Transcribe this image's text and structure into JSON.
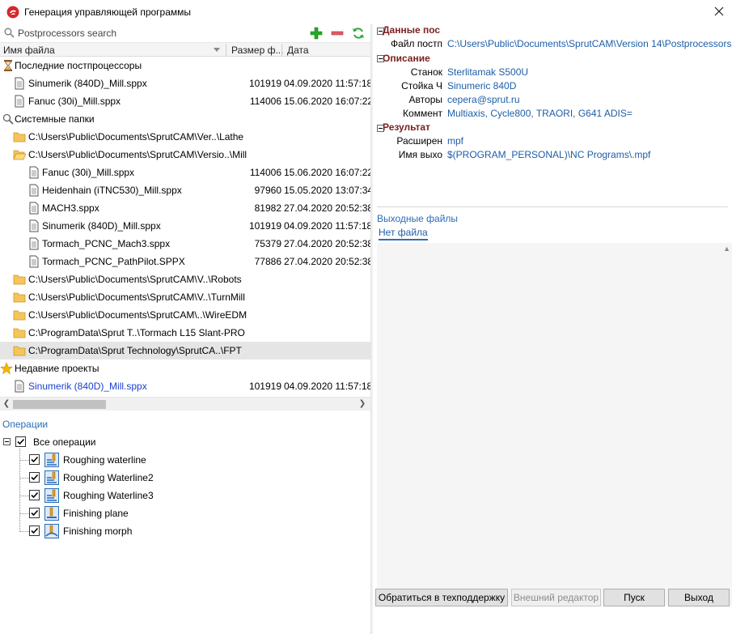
{
  "window": {
    "title": "Генерация управляющей программы"
  },
  "search": {
    "placeholder": "Postprocessors search"
  },
  "columns": {
    "name": "Имя файла",
    "size": "Размер ф...",
    "date": "Дата"
  },
  "tree": {
    "recent_pp": {
      "label": "Последние постпроцессоры",
      "items": [
        {
          "name": "Sinumerik (840D)_Mill.sppx",
          "size": "101919",
          "date": "04.09.2020 11:57:18"
        },
        {
          "name": "Fanuc (30i)_Mill.sppx",
          "size": "114006",
          "date": "15.06.2020 16:07:22"
        }
      ]
    },
    "system": {
      "label": "Системные папки",
      "folders": [
        {
          "path": "C:\\Users\\Public\\Documents\\SprutCAM\\Ver..\\Lathe"
        },
        {
          "path": "C:\\Users\\Public\\Documents\\SprutCAM\\Versio..\\Mill"
        }
      ],
      "mill_items": [
        {
          "name": "Fanuc (30i)_Mill.sppx",
          "size": "114006",
          "date": "15.06.2020 16:07:22"
        },
        {
          "name": "Heidenhain (iTNC530)_Mill.sppx",
          "size": "97960",
          "date": "15.05.2020 13:07:34"
        },
        {
          "name": "MACH3.sppx",
          "size": "81982",
          "date": "27.04.2020 20:52:38"
        },
        {
          "name": "Sinumerik (840D)_Mill.sppx",
          "size": "101919",
          "date": "04.09.2020 11:57:18"
        },
        {
          "name": "Tormach_PCNC_Mach3.sppx",
          "size": "75379",
          "date": "27.04.2020 20:52:38"
        },
        {
          "name": "Tormach_PCNC_PathPilot.SPPX",
          "size": "77886",
          "date": "27.04.2020 20:52:38"
        }
      ],
      "more_folders": [
        {
          "path": "C:\\Users\\Public\\Documents\\SprutCAM\\V..\\Robots"
        },
        {
          "path": "C:\\Users\\Public\\Documents\\SprutCAM\\V..\\TurnMill"
        },
        {
          "path": "C:\\Users\\Public\\Documents\\SprutCAM\\..\\WireEDM"
        },
        {
          "path": "C:\\ProgramData\\Sprut T..\\Tormach L15 Slant-PRO"
        },
        {
          "path": "C:\\ProgramData\\Sprut Technology\\SprutCA..\\FPT"
        }
      ]
    },
    "recent_projects": {
      "label": "Недавние проекты",
      "items": [
        {
          "name": "Sinumerik (840D)_Mill.sppx",
          "size": "101919",
          "date": "04.09.2020 11:57:18"
        }
      ]
    }
  },
  "operations": {
    "title": "Операции",
    "root": "Все операции",
    "items": [
      "Roughing waterline",
      "Roughing Waterline2",
      "Roughing Waterline3",
      "Finishing plane",
      "Finishing morph"
    ]
  },
  "props": {
    "group_data": "Данные пос",
    "pp_file_key": "Файл постп",
    "pp_file_val": "C:\\Users\\Public\\Documents\\SprutCAM\\Version 14\\Postprocessors",
    "group_desc": "Описание",
    "machine_key": "Станок",
    "machine_val": "Sterlitamak S500U",
    "cnc_key": "Стойка Ч",
    "cnc_val": "Sinumeric 840D",
    "authors_key": "Авторы",
    "authors_val": "cepera@sprut.ru",
    "comment_key": "Коммент",
    "comment_val": "Multiaxis, Cycle800, TRAORI, G641 ADIS=",
    "group_result": "Результат",
    "ext_key": "Расширен",
    "ext_val": "mpf",
    "outname_key": "Имя выхо",
    "outname_val": "$(PROGRAM_PERSONAL)\\NC Programs\\.mpf"
  },
  "output": {
    "title": "Выходные файлы",
    "tab": "Нет файла"
  },
  "buttons": {
    "support": "Обратиться в техподдержку",
    "editor": "Внешний редактор",
    "run": "Пуск",
    "exit": "Выход"
  }
}
